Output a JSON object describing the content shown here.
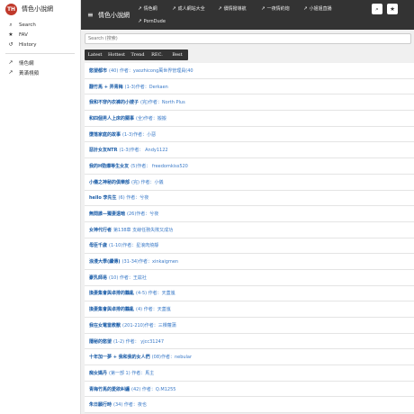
{
  "brand": {
    "logo_text": "TH",
    "title": "情色小說網"
  },
  "sidebar": {
    "items": [
      {
        "icon": "search-icon",
        "glyph": "⌕",
        "label": "Search"
      },
      {
        "icon": "star-icon",
        "glyph": "★",
        "label": "FAV"
      },
      {
        "icon": "history-icon",
        "glyph": "↺",
        "label": "History"
      }
    ],
    "links": [
      {
        "icon": "external-link-icon",
        "glyph": "↗",
        "label": "情色網"
      },
      {
        "icon": "external-link-icon",
        "glyph": "↗",
        "label": "黃滿視頻"
      }
    ]
  },
  "header": {
    "menu_glyph": "≡",
    "title": "情色小說網",
    "links": [
      {
        "label": "情色網"
      },
      {
        "label": "成人網站大全"
      },
      {
        "label": "價情撥導航"
      },
      {
        "label": "一夜情約炮"
      },
      {
        "label": "小姐姐直播"
      },
      {
        "label": "PornDude"
      }
    ],
    "link_glyph": "↗",
    "search_glyph": "⌕",
    "star_glyph": "★"
  },
  "search": {
    "placeholder": "Search (搜索)"
  },
  "tabs": [
    "Latest",
    "Hottest",
    "Trend",
    "REC.",
    "Best"
  ],
  "stories": [
    {
      "title": "慾望都市",
      "meta": "(40) 作者：yaozhicong萬世界管理員(40"
    },
    {
      "title": "翻竹馬 + 弄青梅",
      "meta": "(1-3)作者：Derkaen"
    },
    {
      "title": "我和不穿內衣褲的小嫂子",
      "meta": "(完)作者：North Plus"
    },
    {
      "title": "和四個男人上床的關事",
      "meta": "(全)作者：搬搬"
    },
    {
      "title": "墮落家庭的故事",
      "meta": "(1-3)作者：小惡"
    },
    {
      "title": "惡計女友NTR",
      "meta": "(1-3)作者： Andy1122"
    },
    {
      "title": "我的H勁爆等生女友",
      "meta": "(5)作者： freedomkiss520"
    },
    {
      "title": "小儀之神秘的俱樂部",
      "meta": "(完) 作者：小儀"
    },
    {
      "title": "hello 李先生",
      "meta": "(6) 作者：兮夜"
    },
    {
      "title": "無間誰—獨妻遠暗",
      "meta": "(26)作者：兮夜"
    },
    {
      "title": "女神代行者",
      "meta": "第138章 支線任務失敗又成功"
    },
    {
      "title": "母臣千歲",
      "meta": "(1-10)作者：星浪肉燒靜"
    },
    {
      "title": "浪漫大學(續傳)",
      "meta": "(31-34)作者：xinkaigmen"
    },
    {
      "title": "豪乳師易",
      "meta": "(10) 作者：王茲社"
    },
    {
      "title": "換妻集會與卓排的鸛亂",
      "meta": "(4-5) 作者：天蓋嵐"
    },
    {
      "title": "換妻集會與卓排的鸛亂",
      "meta": "(4) 作者：天蓋嵐"
    },
    {
      "title": "我在女電當教獸",
      "meta": "(201-210)作者：三棵蘿蒲"
    },
    {
      "title": "隱秘的慾望",
      "meta": "(1-2) 作者： yjcc31247"
    },
    {
      "title": "十年加一夢 + 我和我的女人們",
      "meta": "(08)作者：nebular"
    },
    {
      "title": "痴女媽丹",
      "meta": "(第一部 1) 作者：馬主"
    },
    {
      "title": "青梅竹馬的愛欲糾纏",
      "meta": "(42) 作者：Q.M1255"
    },
    {
      "title": "朱日願行時",
      "meta": "(34) 作者：夜也"
    }
  ]
}
